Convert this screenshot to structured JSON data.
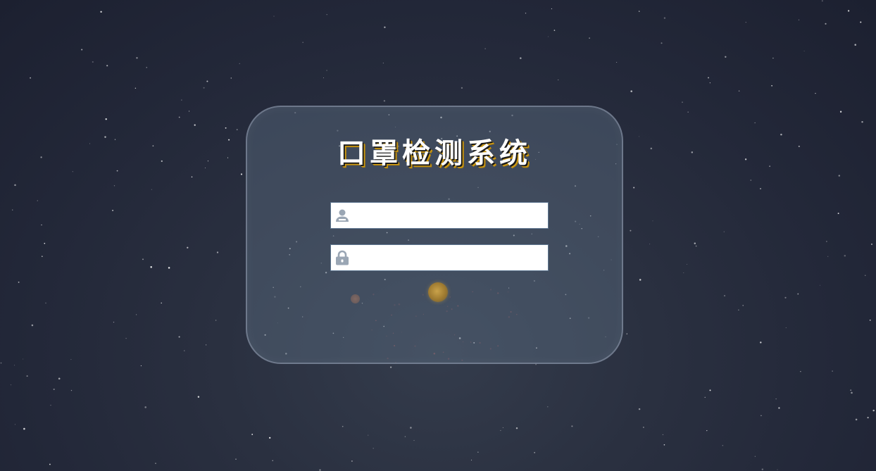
{
  "login": {
    "title": "口罩检测系统",
    "username": {
      "icon": "user-icon",
      "value": "",
      "placeholder": ""
    },
    "password": {
      "icon": "lock-icon",
      "value": "",
      "placeholder": ""
    }
  },
  "colors": {
    "background": "#232839",
    "card": "#4a5a6e",
    "title_text": "#ffffff",
    "title_shadow": "#d4a017",
    "icon": "#9aa6b4",
    "orb": "#c9a24a"
  }
}
